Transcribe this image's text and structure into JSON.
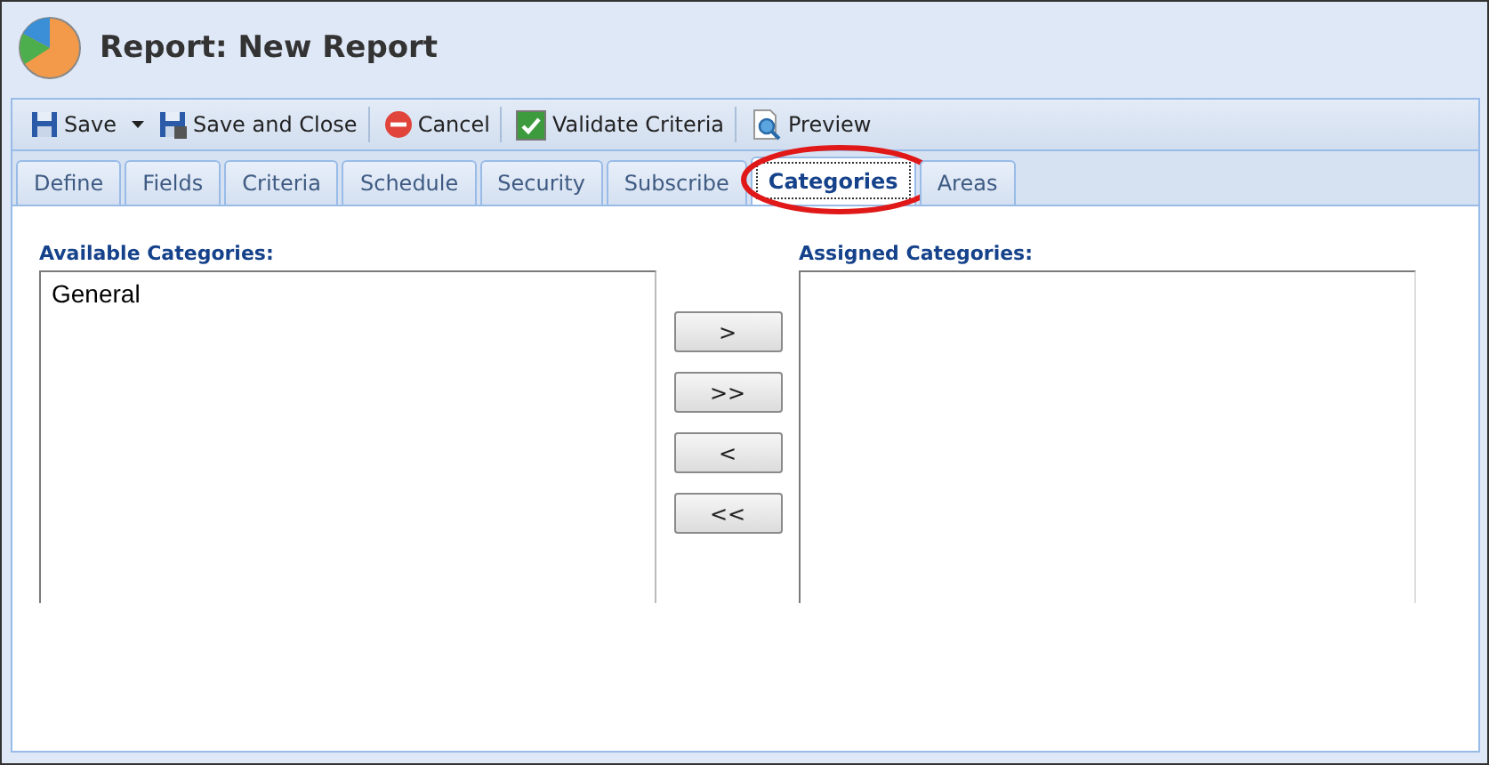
{
  "window": {
    "title": "Report: New Report"
  },
  "toolbar": [
    {
      "label": "Save",
      "kind": "save",
      "dropdown": true,
      "separator": false
    },
    {
      "label": "Save and Close",
      "kind": "save-close",
      "dropdown": false,
      "separator": true
    },
    {
      "label": "Cancel",
      "kind": "cancel",
      "dropdown": false,
      "separator": true
    },
    {
      "label": "Validate Criteria",
      "kind": "validate",
      "dropdown": false,
      "separator": true
    },
    {
      "label": "Preview",
      "kind": "preview",
      "dropdown": false,
      "separator": false
    }
  ],
  "tabs": [
    {
      "label": "Define",
      "selected": false
    },
    {
      "label": "Fields",
      "selected": false
    },
    {
      "label": "Criteria",
      "selected": false
    },
    {
      "label": "Schedule",
      "selected": false
    },
    {
      "label": "Security",
      "selected": false
    },
    {
      "label": "Subscribe",
      "selected": false
    },
    {
      "label": "Categories",
      "selected": true,
      "highlighted": true
    },
    {
      "label": "Areas",
      "selected": false
    }
  ],
  "available": {
    "label": "Available Categories:",
    "items": [
      "General"
    ]
  },
  "move_buttons": [
    ">",
    ">>",
    "<",
    "<<"
  ],
  "assigned": {
    "label": "Assigned Categories:"
  }
}
